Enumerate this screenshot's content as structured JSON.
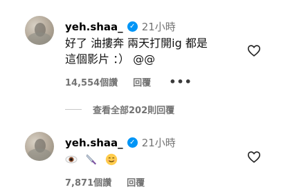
{
  "comments": [
    {
      "username": "yeh.shaa_",
      "time": "21小時",
      "text_line1": "好了 油摟奔 兩天打開ig 都是",
      "text_line2": "這個影片 ：）  @@",
      "likes": "14,554個讚",
      "reply_label": "回覆",
      "more_label": "•••"
    },
    {
      "username": "yeh.shaa_",
      "time": "21小時",
      "emojis": [
        "eye-emoji",
        "knife-emoji",
        "smiling-face-emoji"
      ],
      "likes": "7,871個讚",
      "reply_label": "回覆"
    }
  ],
  "view_replies": "查看全部202則回覆"
}
